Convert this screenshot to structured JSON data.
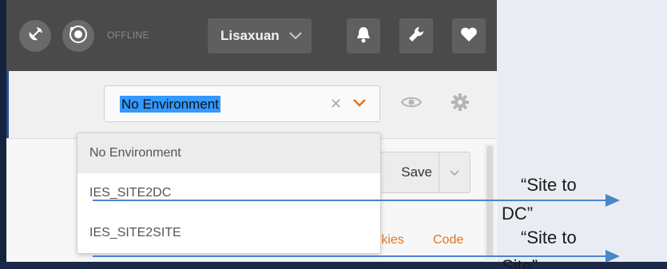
{
  "topbar": {
    "status_label": "OFFLINE",
    "user_name": "Lisaxuan",
    "icons": {
      "satellite": "satellite-dish-icon",
      "sync": "sync-status-icon",
      "user_menu": "chevron-down-icon",
      "notifications": "bell-icon",
      "settings": "wrench-icon",
      "favorites": "heart-icon"
    }
  },
  "environment": {
    "selected_value": "No Environment",
    "options": [
      "No Environment",
      "IES_SITE2DC",
      "IES_SITE2SITE"
    ],
    "icons": {
      "clear": "close-icon",
      "caret": "chevron-down-icon",
      "quick_look": "eye-icon",
      "manage": "gear-icon"
    }
  },
  "request": {
    "save_label": "Save",
    "cookies_label": "Cookies",
    "code_label": "Code"
  },
  "annotations": {
    "site_to_dc_line1": "“Site to",
    "site_to_dc_line2": "DC”",
    "site_to_site_line1": "“Site to",
    "site_to_site_line2": "Site”"
  },
  "colors": {
    "topbar": "#4a4a4a",
    "accent_orange": "#e8731a",
    "selection_blue": "#3399ff",
    "arrow_blue": "#4a86c8",
    "frame_navy": "#1c2a48"
  }
}
